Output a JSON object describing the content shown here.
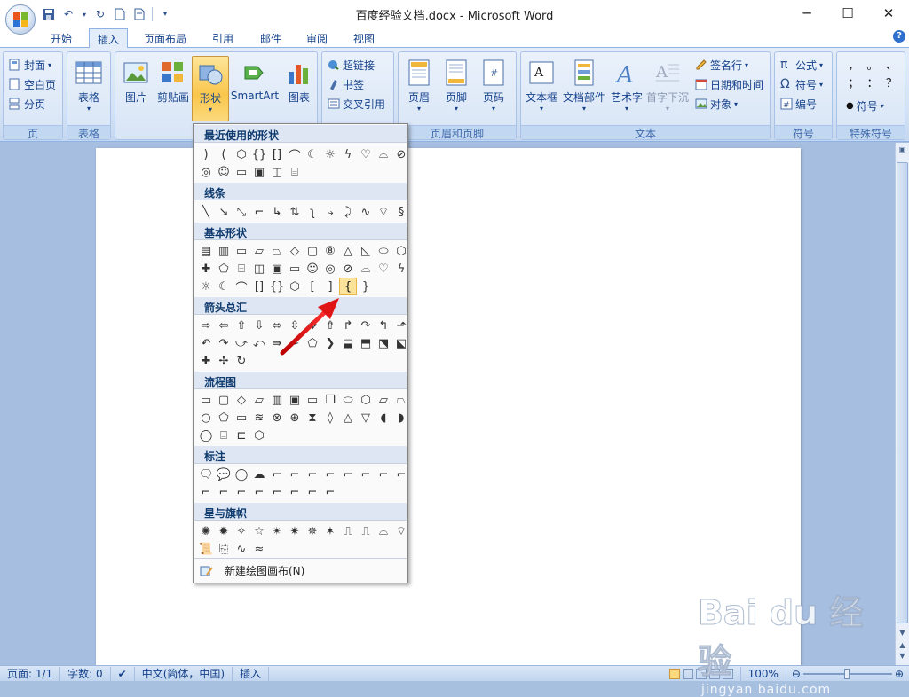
{
  "window": {
    "title": "百度经验文档.docx - Microsoft Word"
  },
  "tabs": [
    "开始",
    "插入",
    "页面布局",
    "引用",
    "邮件",
    "审阅",
    "视图"
  ],
  "selected_tab": "插入",
  "ribbon": {
    "page_group": {
      "label": "页",
      "items": [
        "封面",
        "空白页",
        "分页"
      ]
    },
    "table_group": {
      "label": "表格",
      "button": "表格"
    },
    "illustrations": {
      "buttons": [
        "图片",
        "剪贴画",
        "形状",
        "SmartArt",
        "图表"
      ]
    },
    "links": {
      "items": [
        "超链接",
        "书签",
        "交叉引用"
      ]
    },
    "header_footer": {
      "label": "页眉和页脚",
      "buttons": [
        "页眉",
        "页脚",
        "页码"
      ]
    },
    "text": {
      "label": "文本",
      "buttons": [
        "文本框",
        "文档部件",
        "艺术字",
        "首字下沉"
      ],
      "items": [
        "签名行",
        "日期和时间",
        "对象"
      ]
    },
    "symbols": {
      "label": "符号",
      "items": [
        "公式",
        "符号",
        "编号"
      ]
    },
    "special": {
      "label": "特殊符号",
      "grid": [
        "，",
        "。",
        "、",
        "；",
        "：",
        "？"
      ],
      "more": "符号"
    }
  },
  "shapes_menu": {
    "sections": [
      "最近使用的形状",
      "线条",
      "基本形状",
      "箭头总汇",
      "流程图",
      "标注",
      "星与旗帜"
    ],
    "footer": "新建绘图画布(N)"
  },
  "status": {
    "page": "页面: 1/1",
    "words": "字数: 0",
    "language": "中文(简体，中国)",
    "mode": "插入",
    "zoom": "100%"
  },
  "watermark": {
    "brand": "Bai du 经验",
    "url": "jingyan.baidu.com"
  }
}
